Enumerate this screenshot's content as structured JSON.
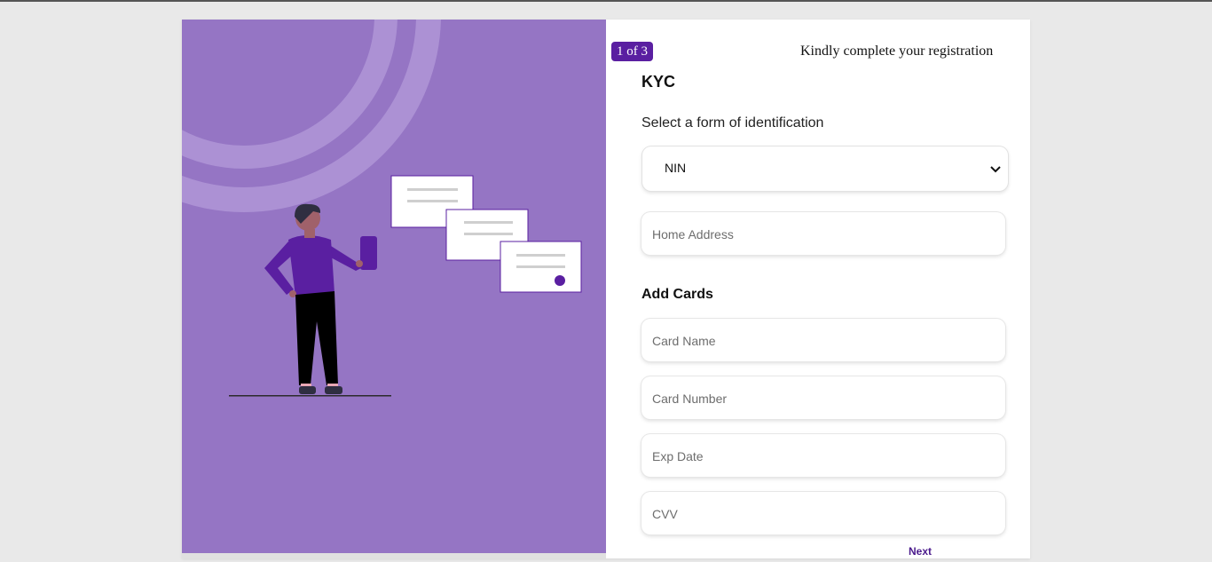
{
  "step": {
    "label": "1 of 3"
  },
  "header": {
    "note": "Kindly complete your registration"
  },
  "kyc": {
    "title": "KYC",
    "id_label": "Select a form of identification",
    "id_selected": "NIN",
    "home_address_placeholder": "Home Address"
  },
  "cards": {
    "title": "Add Cards",
    "card_name_placeholder": "Card Name",
    "card_number_placeholder": "Card Number",
    "exp_date_placeholder": "Exp Date",
    "cvv_placeholder": "CVV"
  },
  "actions": {
    "next_label": "Next"
  },
  "colors": {
    "panel": "#9575c4",
    "accent": "#5a1fa1",
    "page_bg": "#e9e9e9"
  },
  "icons": {
    "select_chevron": "chevron-down-icon",
    "illustration": "person-holding-phone-illustration"
  }
}
